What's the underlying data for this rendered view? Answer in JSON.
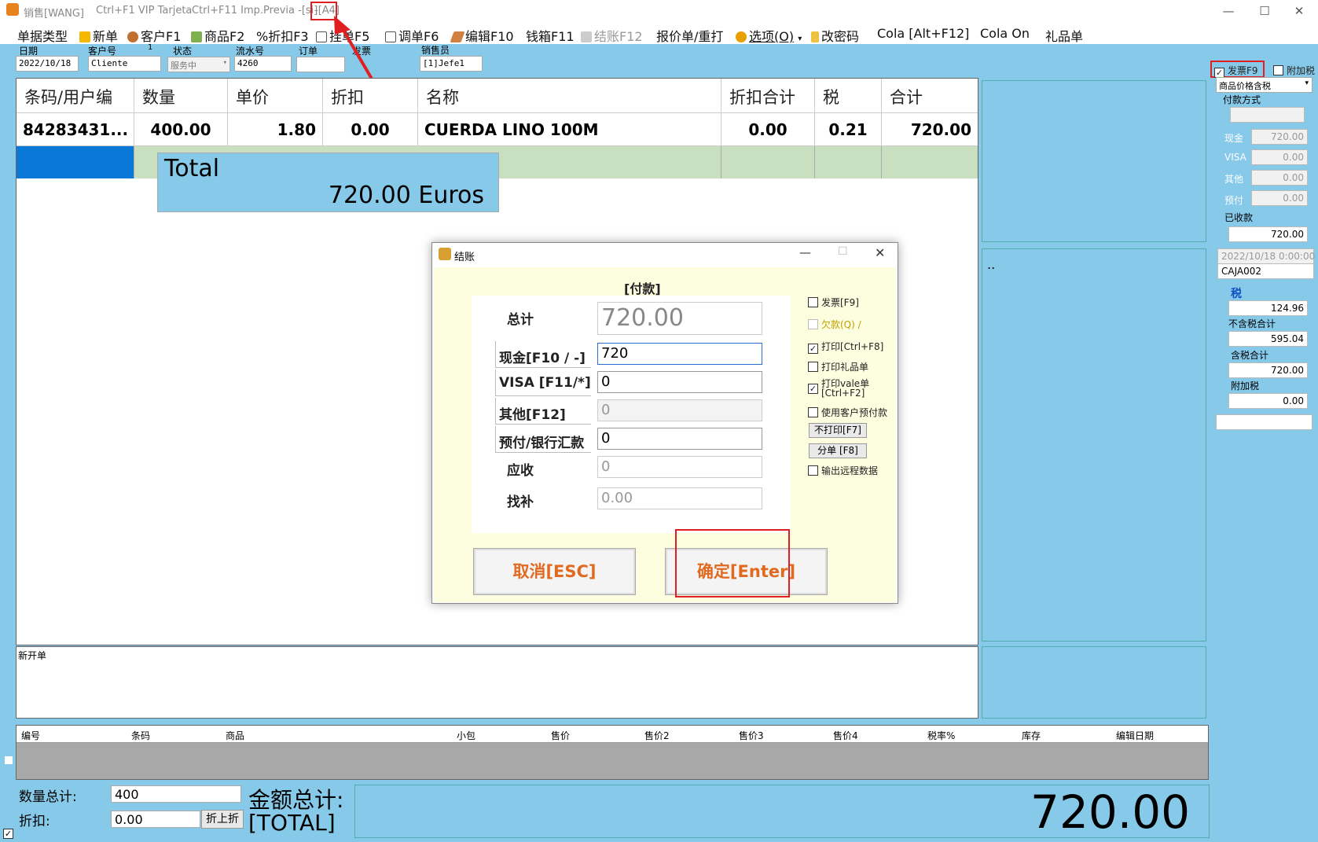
{
  "titlebar": {
    "app": "销售[WANG]",
    "hint1": "Ctrl+F1 VIP Tarjeta",
    "hint2": "Ctrl+F11 Imp.Previa -[si]",
    "hint3": "-[A4]"
  },
  "toolbar": [
    {
      "label": "单据类型",
      "icon": "none"
    },
    {
      "label": "新单",
      "icon": "plus-icon"
    },
    {
      "label": "客户F1",
      "icon": "users-icon"
    },
    {
      "label": "商品F2",
      "icon": "product-icon"
    },
    {
      "label": "%折扣F3",
      "icon": "none"
    },
    {
      "label": "挂单F5",
      "icon": "document-icon"
    },
    {
      "label": "调单F6",
      "icon": "document-icon"
    },
    {
      "label": "编辑F10",
      "icon": "pencil-icon"
    },
    {
      "label": "钱箱F11",
      "icon": "none"
    },
    {
      "label": "结账F12",
      "icon": "checkout-icon",
      "disabled": true
    },
    {
      "label": "报价单/重打",
      "icon": "none"
    },
    {
      "label": "选项(O)",
      "icon": "gear-icon"
    },
    {
      "label": "改密码",
      "icon": "lock-icon"
    },
    {
      "label": "Cola [Alt+F12]",
      "icon": "none"
    },
    {
      "label": "Cola On",
      "icon": "none"
    },
    {
      "label": "礼品单",
      "icon": "none"
    }
  ],
  "header": {
    "date_label": "日期",
    "date": "2022/10/18",
    "customer_label": "客户号",
    "customer_num": "1",
    "customer": "Cliente",
    "status_label": "状态",
    "status": "服务中",
    "serial_label": "流水号",
    "serial": "4260",
    "order_label": "订单",
    "order": "",
    "invoice_label": "发票",
    "seller_label": "销售员",
    "seller": "[1]Jefe1"
  },
  "grid": {
    "columns": [
      "条码/用户编",
      "数量",
      "单价",
      "折扣",
      "名称",
      "折扣合计",
      "税",
      "合计"
    ],
    "rows": [
      [
        "84283431...",
        "400.00",
        "1.80",
        "0.00",
        "CUERDA LINO 100M",
        "0.00",
        "0.21",
        "720.00"
      ]
    ],
    "total_label": "Total",
    "total_value": "720.00 Euros"
  },
  "right": {
    "invoice_chk": "发票F9",
    "surcharge_chk": "附加税",
    "price_mode": "商品价格含税",
    "payment_label": "付款方式",
    "cash_label": "现金",
    "cash": "720.00",
    "visa_label": "VISA",
    "visa": "0.00",
    "other_label": "其他",
    "other": "0.00",
    "prepaid_label": "预付",
    "prepaid": "0.00",
    "received_label": "已收款",
    "received": "720.00",
    "datetime": "2022/10/18 0:00:00",
    "caja": "CAJA002",
    "tax_label": "税",
    "tax": "124.96",
    "notax_label": "不含税合计",
    "notax": "595.04",
    "withtax_label": "含税合计",
    "withtax": "720.00",
    "extra_label": "附加税",
    "extra": "0.00",
    "dots": ".."
  },
  "dialog": {
    "title": "结账",
    "section": "[付款]",
    "total_label": "总计",
    "total": "720.00",
    "cash_label": "现金[F10 / -]",
    "cash": "720",
    "visa_label": "VISA [F11/*]",
    "visa": "0",
    "other_label": "其他[F12]",
    "other": "0",
    "prepaid_label": "预付/银行汇款",
    "prepaid": "0",
    "due_label": "应收",
    "due": "0",
    "change_label": "找补",
    "change": "0.00",
    "opt_invoice": "发票[F9]",
    "opt_debt": "欠款(Q) /",
    "opt_print": "打印[Ctrl+F8]",
    "opt_gift": "打印礼品单",
    "opt_vale": "打印vale单 [Ctrl+F2]",
    "opt_prepay": "使用客户预付款",
    "noprint_btn": "不打印[F7]",
    "split_btn": "分单 [F8]",
    "opt_remote": "输出远程数据",
    "cancel_btn": "取消[ESC]",
    "ok_btn": "确定[Enter]"
  },
  "memo": {
    "label": "新开单"
  },
  "bottom_table": {
    "columns": [
      "编号",
      "条码",
      "商品",
      "小包",
      "售价",
      "售价2",
      "售价3",
      "售价4",
      "税率%",
      "库存",
      "编辑日期"
    ]
  },
  "footer": {
    "qty_label": "数量总计:",
    "qty": "400",
    "disc_label": "折扣:",
    "disc": "0.00",
    "disc_btn": "折上折",
    "amount_label": "金额总计:",
    "amount_label2": "[TOTAL]",
    "amount": "720.00"
  },
  "colors": {
    "panel": "#87c9e9",
    "grid_green": "#c8dfc0",
    "selected": "#0a78d7",
    "accent": "#e06a20",
    "highlight": "#e02020"
  }
}
